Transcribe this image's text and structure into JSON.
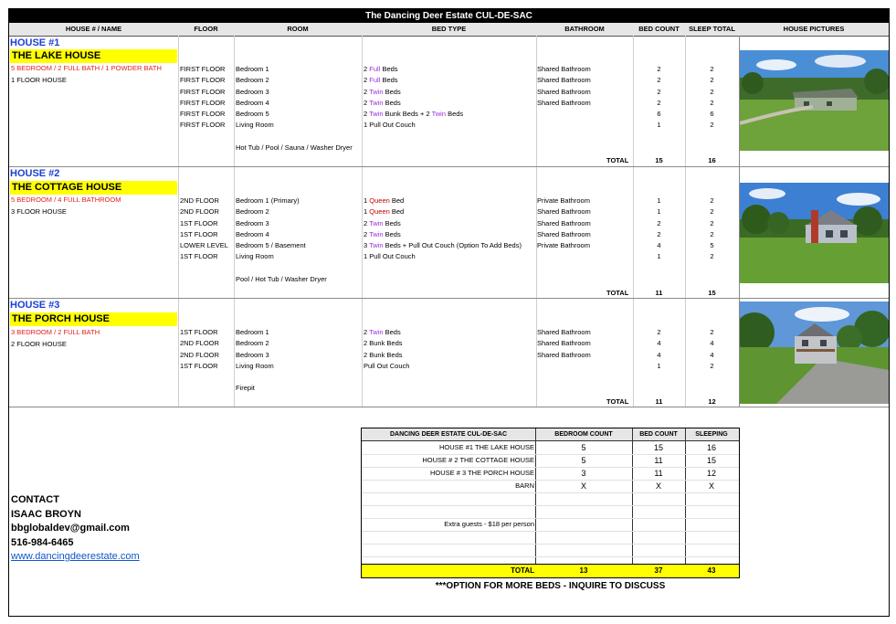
{
  "title": "The Dancing Deer Estate CUL-DE-SAC",
  "headers": {
    "house": "HOUSE # / NAME",
    "floor": "FLOOR",
    "room": "ROOM",
    "bed_type": "BED TYPE",
    "bathroom": "BATHROOM",
    "bed_count": "BED COUNT",
    "sleep_total": "SLEEP TOTAL",
    "pictures": "HOUSE PICTURES"
  },
  "houses": [
    {
      "num": "HOUSE #1",
      "name": "THE LAKE HOUSE",
      "desc": "5 BEDROOM / 2 FULL BATH  / 1 POWDER BATH",
      "floors_desc": "1 FLOOR HOUSE",
      "rows": [
        {
          "floor": "FIRST FLOOR",
          "room": "Bedroom 1",
          "bed_pre": "2 ",
          "bed_kw": "Full",
          "bed_post": " Beds",
          "bath": "Shared Bathroom",
          "count": "2",
          "sleep": "2"
        },
        {
          "floor": "FIRST FLOOR",
          "room": "Bedroom 2",
          "bed_pre": "2 ",
          "bed_kw": "Full",
          "bed_post": " Beds",
          "bath": "Shared Bathroom",
          "count": "2",
          "sleep": "2"
        },
        {
          "floor": "FIRST FLOOR",
          "room": "Bedroom 3",
          "bed_pre": "2 ",
          "bed_kw": "Twin",
          "bed_post": " Beds",
          "bath": "Shared Bathroom",
          "count": "2",
          "sleep": "2"
        },
        {
          "floor": "FIRST FLOOR",
          "room": "Bedroom 4",
          "bed_pre": "2 ",
          "bed_kw": "Twin",
          "bed_post": " Beds",
          "bath": "Shared Bathroom",
          "count": "2",
          "sleep": "2"
        },
        {
          "floor": "FIRST FLOOR",
          "room": "Bedroom 5",
          "bed_pre": "2 ",
          "bed_kw": "Twin",
          "bed_post": " Bunk Beds + 2 ",
          "bed_kw2": "Twin",
          "bed_post2": " Beds",
          "bath": "",
          "count": "6",
          "sleep": "6"
        },
        {
          "floor": "FIRST FLOOR",
          "room": "Living Room",
          "bed_pre": "1 Pull Out Couch",
          "bed_kw": "",
          "bed_post": "",
          "bath": "",
          "count": "1",
          "sleep": "2"
        }
      ],
      "amenities": "Hot Tub / Pool / Sauna / Washer Dryer",
      "total_label": "TOTAL",
      "total_count": "15",
      "total_sleep": "16"
    },
    {
      "num": "HOUSE #2",
      "name": "THE COTTAGE HOUSE",
      "desc": "5 BEDROOM / 4 FULL BATHROOM",
      "floors_desc": "3 FLOOR HOUSE",
      "rows": [
        {
          "floor": "2ND FLOOR",
          "room": "Bedroom 1 (Primary)",
          "bed_pre": "1 ",
          "bed_kw": "Queen",
          "bed_post": " Bed",
          "kwclass": "darkred",
          "bath": "Private Bathroom",
          "count": "1",
          "sleep": "2"
        },
        {
          "floor": "2ND FLOOR",
          "room": "Bedroom 2",
          "bed_pre": "1 ",
          "bed_kw": "Queen",
          "bed_post": " Bed",
          "kwclass": "darkred",
          "bath": "Shared Bathroom",
          "count": "1",
          "sleep": "2"
        },
        {
          "floor": "1ST FLOOR",
          "room": "Bedroom 3",
          "bed_pre": "2 ",
          "bed_kw": "Twin",
          "bed_post": " Beds",
          "bath": "Shared Bathroom",
          "count": "2",
          "sleep": "2"
        },
        {
          "floor": "1ST FLOOR",
          "room": "Bedroom 4",
          "bed_pre": "2 ",
          "bed_kw": "Twin",
          "bed_post": " Beds",
          "bath": "Shared Bathroom",
          "count": "2",
          "sleep": "2"
        },
        {
          "floor": "LOWER LEVEL",
          "room": "Bedroom 5 / Basement",
          "bed_pre": "3 ",
          "bed_kw": "Twin",
          "bed_post": " Beds + Pull Out Couch (Option To Add Beds)",
          "bath": "Private Bathroom",
          "count": "4",
          "sleep": "5"
        },
        {
          "floor": "1ST FLOOR",
          "room": "Living Room",
          "bed_pre": "1 Pull Out Couch",
          "bed_kw": "",
          "bed_post": "",
          "bath": "",
          "count": "1",
          "sleep": "2"
        }
      ],
      "amenities": "Pool / Hot Tub / Washer Dryer",
      "total_label": "TOTAL",
      "total_count": "11",
      "total_sleep": "15"
    },
    {
      "num": "HOUSE #3",
      "name": "THE PORCH HOUSE",
      "desc": "3 BEDROOM / 2 FULL BATH",
      "floors_desc": "2 FLOOR HOUSE",
      "rows": [
        {
          "floor": "1ST FLOOR",
          "room": "Bedroom 1",
          "bed_pre": "2 ",
          "bed_kw": "Twin",
          "bed_post": " Beds",
          "bath": "Shared Bathroom",
          "count": "2",
          "sleep": "2"
        },
        {
          "floor": "2ND FLOOR",
          "room": "Bedroom 2",
          "bed_pre": "2 Bunk Beds",
          "bed_kw": "",
          "bed_post": "",
          "bath": "Shared Bathroom",
          "count": "4",
          "sleep": "4"
        },
        {
          "floor": "2ND FLOOR",
          "room": "Bedroom 3",
          "bed_pre": "2 Bunk Beds",
          "bed_kw": "",
          "bed_post": "",
          "bath": "Shared Bathroom",
          "count": "4",
          "sleep": "4"
        },
        {
          "floor": "1ST FLOOR",
          "room": "Living Room",
          "bed_pre": "Pull Out Couch",
          "bed_kw": "",
          "bed_post": "",
          "bath": "",
          "count": "1",
          "sleep": "2"
        }
      ],
      "amenities": "Firepit",
      "total_label": "TOTAL",
      "total_count": "11",
      "total_sleep": "12"
    }
  ],
  "summary": {
    "headers": {
      "name": "DANCING DEER ESTATE CUL-DE-SAC",
      "bedrooms": "BEDROOM COUNT",
      "beds": "BED COUNT",
      "sleeping": "SLEEPING"
    },
    "rows": [
      {
        "name": "HOUSE #1  THE LAKE HOUSE",
        "bedrooms": "5",
        "beds": "15",
        "sleeping": "16"
      },
      {
        "name": "HOUSE # 2  THE COTTAGE HOUSE",
        "bedrooms": "5",
        "beds": "11",
        "sleeping": "15"
      },
      {
        "name": "HOUSE # 3  THE PORCH HOUSE",
        "bedrooms": "3",
        "beds": "11",
        "sleeping": "12"
      },
      {
        "name": "BARN",
        "bedrooms": "X",
        "beds": "X",
        "sleeping": "X"
      },
      {
        "name": "",
        "bedrooms": "",
        "beds": "",
        "sleeping": ""
      },
      {
        "name": "",
        "bedrooms": "",
        "beds": "",
        "sleeping": ""
      },
      {
        "name": "Extra guests - $18 per person",
        "bedrooms": "",
        "beds": "",
        "sleeping": ""
      },
      {
        "name": "",
        "bedrooms": "",
        "beds": "",
        "sleeping": ""
      },
      {
        "name": "",
        "bedrooms": "",
        "beds": "",
        "sleeping": ""
      }
    ],
    "total": {
      "name": "TOTAL",
      "bedrooms": "13",
      "beds": "37",
      "sleeping": "43"
    },
    "note": "***OPTION FOR MORE BEDS - INQUIRE TO DISCUSS"
  },
  "contact": {
    "heading": "CONTACT",
    "name": "ISAAC BROYN",
    "email": "bbglobaldev@gmail.com",
    "phone": "516-984-6465",
    "website": "www.dancingdeerestate.com"
  },
  "colors": {
    "house_num": "#1a3fd6",
    "highlight": "#ffff00",
    "desc_red": "#e31c1c",
    "kw_purple": "#9a2ddb",
    "link": "#1155cc"
  }
}
